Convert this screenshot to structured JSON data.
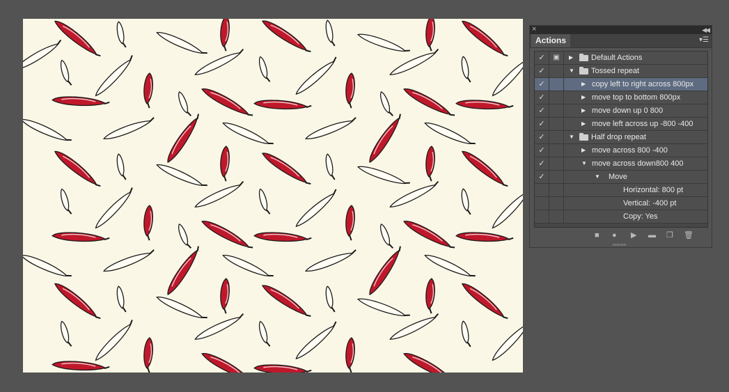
{
  "panel": {
    "tab_label": "Actions",
    "close_icon": "close-icon",
    "collapse_icon": "collapse-icon",
    "menu_icon": "panel-menu-icon",
    "rows": [
      {
        "label": "Default Actions",
        "checked": true,
        "dialog": true,
        "kind": "set",
        "expanded": false,
        "level": 0
      },
      {
        "label": "Tossed repeat",
        "checked": true,
        "dialog": false,
        "kind": "set",
        "expanded": true,
        "level": 0
      },
      {
        "label": "copy left to right across 800px",
        "checked": true,
        "dialog": false,
        "kind": "action",
        "expanded": false,
        "level": 1,
        "selected": true
      },
      {
        "label": "move top to bottom 800px",
        "checked": true,
        "dialog": false,
        "kind": "action",
        "expanded": false,
        "level": 1
      },
      {
        "label": "move down up 0  800",
        "checked": true,
        "dialog": false,
        "kind": "action",
        "expanded": false,
        "level": 1
      },
      {
        "label": "move left across up -800 -400",
        "checked": true,
        "dialog": false,
        "kind": "action",
        "expanded": false,
        "level": 1
      },
      {
        "label": "Half drop repeat",
        "checked": true,
        "dialog": false,
        "kind": "set",
        "expanded": true,
        "level": 0
      },
      {
        "label": "move across 800 -400",
        "checked": true,
        "dialog": false,
        "kind": "action",
        "expanded": false,
        "level": 1
      },
      {
        "label": "move across down800 400",
        "checked": true,
        "dialog": false,
        "kind": "action",
        "expanded": true,
        "level": 1
      },
      {
        "label": "Move",
        "checked": true,
        "dialog": false,
        "kind": "command",
        "expanded": true,
        "level": 2
      },
      {
        "label": "Horizontal: 800 pt",
        "checked": false,
        "dialog": false,
        "kind": "param",
        "level": 3
      },
      {
        "label": "Vertical: -400 pt",
        "checked": false,
        "dialog": false,
        "kind": "param",
        "level": 3
      },
      {
        "label": "Copy: Yes",
        "checked": false,
        "dialog": false,
        "kind": "param",
        "level": 3
      }
    ],
    "footer_buttons": [
      "stop-icon",
      "record-icon",
      "play-icon",
      "new-set-icon",
      "new-action-icon",
      "trash-icon"
    ]
  },
  "artboard": {
    "background": "#fbf7e6",
    "pattern": "chili peppers",
    "pepper_red": "#c0182b",
    "outline": "#1a1a1a"
  }
}
